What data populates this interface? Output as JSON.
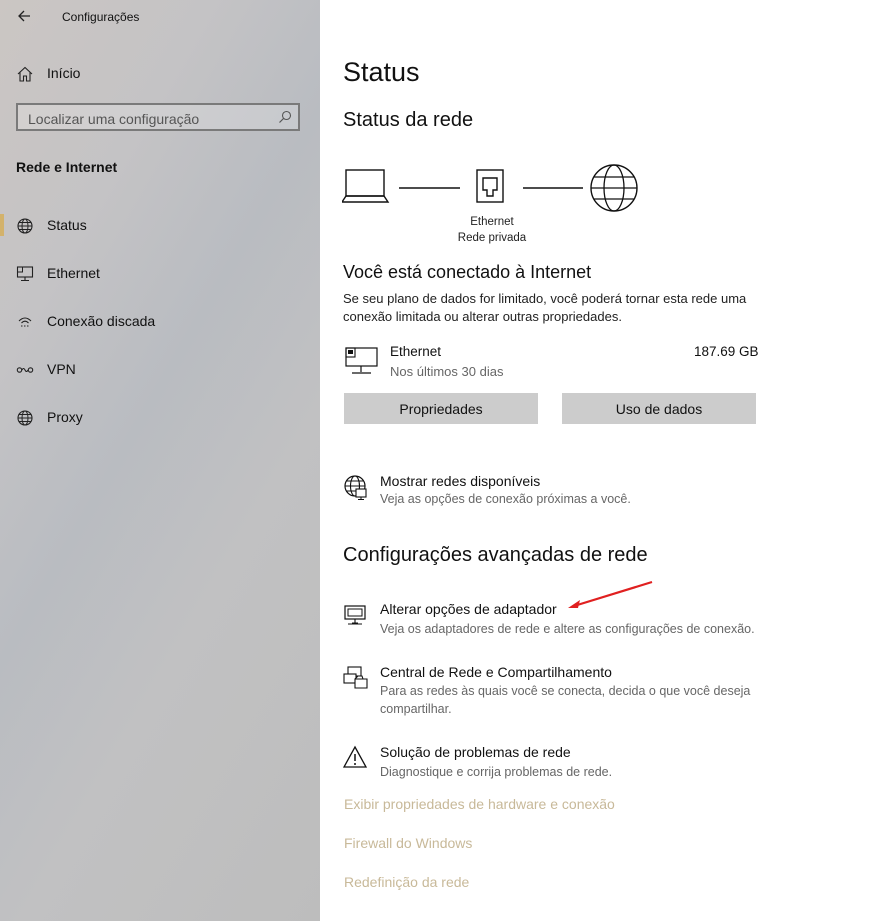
{
  "window": {
    "title": "Configurações"
  },
  "sidebar": {
    "home_label": "Início",
    "search_placeholder": "Localizar uma configuração",
    "section_title": "Rede e Internet",
    "items": [
      {
        "label": "Status",
        "icon": "globe-icon",
        "active": true
      },
      {
        "label": "Ethernet",
        "icon": "ethernet-icon",
        "active": false
      },
      {
        "label": "Conexão discada",
        "icon": "dialup-icon",
        "active": false
      },
      {
        "label": "VPN",
        "icon": "vpn-icon",
        "active": false
      },
      {
        "label": "Proxy",
        "icon": "globe-icon",
        "active": false
      }
    ]
  },
  "main": {
    "title": "Status",
    "network_status_heading": "Status da rede",
    "diagram": {
      "line1": "Ethernet",
      "line2": "Rede privada"
    },
    "connected_heading": "Você está conectado à Internet",
    "connected_text": "Se seu plano de dados for limitado, você poderá tornar esta rede uma conexão limitada ou alterar outras propriedades.",
    "adapter": {
      "name": "Ethernet",
      "period": "Nos últimos 30 dias",
      "usage": "187.69 GB"
    },
    "buttons": {
      "properties": "Propriedades",
      "data_usage": "Uso de dados"
    },
    "show_networks": {
      "title": "Mostrar redes disponíveis",
      "desc": "Veja as opções de conexão próximas a você."
    },
    "advanced_heading": "Configurações avançadas de rede",
    "advanced_items": [
      {
        "title": "Alterar opções de adaptador",
        "desc": "Veja os adaptadores de rede e altere as configurações de conexão."
      },
      {
        "title": "Central de Rede e Compartilhamento",
        "desc": "Para as redes às quais você se conecta, decida o que você deseja compartilhar."
      },
      {
        "title": "Solução de problemas de rede",
        "desc": "Diagnostique e corrija problemas de rede."
      }
    ],
    "links": [
      "Exibir propriedades de hardware e conexão",
      "Firewall do Windows",
      "Redefinição da rede"
    ]
  },
  "colors": {
    "accent": "#d3b26b",
    "link": "#c8b999",
    "button": "#cccccc",
    "annotation_arrow": "#e02020"
  }
}
